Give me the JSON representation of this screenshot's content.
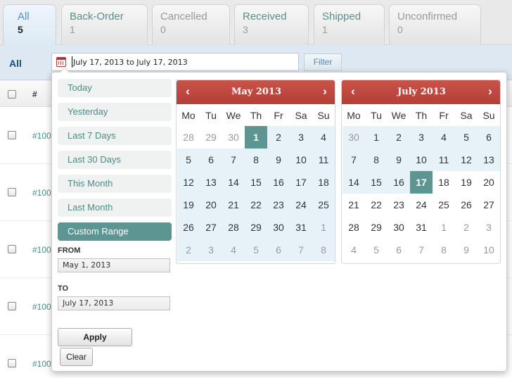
{
  "tabs": [
    {
      "label": "All",
      "count": "5"
    },
    {
      "label": "Back-Order",
      "count": "1"
    },
    {
      "label": "Cancelled",
      "count": "0"
    },
    {
      "label": "Received",
      "count": "3"
    },
    {
      "label": "Shipped",
      "count": "1"
    },
    {
      "label": "Unconfirmed",
      "count": "0"
    }
  ],
  "filter_bar": {
    "all_label": "All",
    "date_range": "July 17, 2013 to July 17, 2013",
    "filter_button": "Filter"
  },
  "table": {
    "hash_header": "#",
    "order_prefix": [
      "#100",
      "#100",
      "#100",
      "#100",
      "#100"
    ]
  },
  "picker": {
    "ranges": [
      "Today",
      "Yesterday",
      "Last 7 Days",
      "Last 30 Days",
      "This Month",
      "Last Month",
      "Custom Range"
    ],
    "active_range": "Custom Range",
    "from_label": "FROM",
    "from_value": "May 1, 2013",
    "to_label": "TO",
    "to_value": "July 17, 2013",
    "apply_button": "Apply",
    "clear_button": "Clear",
    "prev_icon": "‹",
    "next_icon": "›",
    "weekdays": [
      "Mo",
      "Tu",
      "We",
      "Th",
      "Fr",
      "Sa",
      "Su"
    ],
    "calendars": [
      {
        "title": "May 2013",
        "days": [
          {
            "d": "28",
            "m": true,
            "r": false,
            "s": false
          },
          {
            "d": "29",
            "m": true,
            "r": false,
            "s": false
          },
          {
            "d": "30",
            "m": true,
            "r": false,
            "s": false
          },
          {
            "d": "1",
            "m": false,
            "r": true,
            "s": true
          },
          {
            "d": "2",
            "m": false,
            "r": true,
            "s": false
          },
          {
            "d": "3",
            "m": false,
            "r": true,
            "s": false
          },
          {
            "d": "4",
            "m": false,
            "r": true,
            "s": false
          },
          {
            "d": "5",
            "m": false,
            "r": true,
            "s": false
          },
          {
            "d": "6",
            "m": false,
            "r": true,
            "s": false
          },
          {
            "d": "7",
            "m": false,
            "r": true,
            "s": false
          },
          {
            "d": "8",
            "m": false,
            "r": true,
            "s": false
          },
          {
            "d": "9",
            "m": false,
            "r": true,
            "s": false
          },
          {
            "d": "10",
            "m": false,
            "r": true,
            "s": false
          },
          {
            "d": "11",
            "m": false,
            "r": true,
            "s": false
          },
          {
            "d": "12",
            "m": false,
            "r": true,
            "s": false
          },
          {
            "d": "13",
            "m": false,
            "r": true,
            "s": false
          },
          {
            "d": "14",
            "m": false,
            "r": true,
            "s": false
          },
          {
            "d": "15",
            "m": false,
            "r": true,
            "s": false
          },
          {
            "d": "16",
            "m": false,
            "r": true,
            "s": false
          },
          {
            "d": "17",
            "m": false,
            "r": true,
            "s": false
          },
          {
            "d": "18",
            "m": false,
            "r": true,
            "s": false
          },
          {
            "d": "19",
            "m": false,
            "r": true,
            "s": false
          },
          {
            "d": "20",
            "m": false,
            "r": true,
            "s": false
          },
          {
            "d": "21",
            "m": false,
            "r": true,
            "s": false
          },
          {
            "d": "22",
            "m": false,
            "r": true,
            "s": false
          },
          {
            "d": "23",
            "m": false,
            "r": true,
            "s": false
          },
          {
            "d": "24",
            "m": false,
            "r": true,
            "s": false
          },
          {
            "d": "25",
            "m": false,
            "r": true,
            "s": false
          },
          {
            "d": "26",
            "m": false,
            "r": true,
            "s": false
          },
          {
            "d": "27",
            "m": false,
            "r": true,
            "s": false
          },
          {
            "d": "28",
            "m": false,
            "r": true,
            "s": false
          },
          {
            "d": "29",
            "m": false,
            "r": true,
            "s": false
          },
          {
            "d": "30",
            "m": false,
            "r": true,
            "s": false
          },
          {
            "d": "31",
            "m": false,
            "r": true,
            "s": false
          },
          {
            "d": "1",
            "m": true,
            "r": true,
            "s": false
          },
          {
            "d": "2",
            "m": true,
            "r": true,
            "s": false
          },
          {
            "d": "3",
            "m": true,
            "r": true,
            "s": false
          },
          {
            "d": "4",
            "m": true,
            "r": true,
            "s": false
          },
          {
            "d": "5",
            "m": true,
            "r": true,
            "s": false
          },
          {
            "d": "6",
            "m": true,
            "r": true,
            "s": false
          },
          {
            "d": "7",
            "m": true,
            "r": true,
            "s": false
          },
          {
            "d": "8",
            "m": true,
            "r": true,
            "s": false
          }
        ]
      },
      {
        "title": "July 2013",
        "days": [
          {
            "d": "30",
            "m": true,
            "r": true,
            "s": false
          },
          {
            "d": "1",
            "m": false,
            "r": true,
            "s": false
          },
          {
            "d": "2",
            "m": false,
            "r": true,
            "s": false
          },
          {
            "d": "3",
            "m": false,
            "r": true,
            "s": false
          },
          {
            "d": "4",
            "m": false,
            "r": true,
            "s": false
          },
          {
            "d": "5",
            "m": false,
            "r": true,
            "s": false
          },
          {
            "d": "6",
            "m": false,
            "r": true,
            "s": false
          },
          {
            "d": "7",
            "m": false,
            "r": true,
            "s": false
          },
          {
            "d": "8",
            "m": false,
            "r": true,
            "s": false
          },
          {
            "d": "9",
            "m": false,
            "r": true,
            "s": false
          },
          {
            "d": "10",
            "m": false,
            "r": true,
            "s": false
          },
          {
            "d": "11",
            "m": false,
            "r": true,
            "s": false
          },
          {
            "d": "12",
            "m": false,
            "r": true,
            "s": false
          },
          {
            "d": "13",
            "m": false,
            "r": true,
            "s": false
          },
          {
            "d": "14",
            "m": false,
            "r": true,
            "s": false
          },
          {
            "d": "15",
            "m": false,
            "r": true,
            "s": false
          },
          {
            "d": "16",
            "m": false,
            "r": true,
            "s": false
          },
          {
            "d": "17",
            "m": false,
            "r": false,
            "s": true
          },
          {
            "d": "18",
            "m": false,
            "r": false,
            "s": false
          },
          {
            "d": "19",
            "m": false,
            "r": false,
            "s": false
          },
          {
            "d": "20",
            "m": false,
            "r": false,
            "s": false
          },
          {
            "d": "21",
            "m": false,
            "r": false,
            "s": false
          },
          {
            "d": "22",
            "m": false,
            "r": false,
            "s": false
          },
          {
            "d": "23",
            "m": false,
            "r": false,
            "s": false
          },
          {
            "d": "24",
            "m": false,
            "r": false,
            "s": false
          },
          {
            "d": "25",
            "m": false,
            "r": false,
            "s": false
          },
          {
            "d": "26",
            "m": false,
            "r": false,
            "s": false
          },
          {
            "d": "27",
            "m": false,
            "r": false,
            "s": false
          },
          {
            "d": "28",
            "m": false,
            "r": false,
            "s": false
          },
          {
            "d": "29",
            "m": false,
            "r": false,
            "s": false
          },
          {
            "d": "30",
            "m": false,
            "r": false,
            "s": false
          },
          {
            "d": "31",
            "m": false,
            "r": false,
            "s": false
          },
          {
            "d": "1",
            "m": true,
            "r": false,
            "s": false
          },
          {
            "d": "2",
            "m": true,
            "r": false,
            "s": false
          },
          {
            "d": "3",
            "m": true,
            "r": false,
            "s": false
          },
          {
            "d": "4",
            "m": true,
            "r": false,
            "s": false
          },
          {
            "d": "5",
            "m": true,
            "r": false,
            "s": false
          },
          {
            "d": "6",
            "m": true,
            "r": false,
            "s": false
          },
          {
            "d": "7",
            "m": true,
            "r": false,
            "s": false
          },
          {
            "d": "8",
            "m": true,
            "r": false,
            "s": false
          },
          {
            "d": "9",
            "m": true,
            "r": false,
            "s": false
          },
          {
            "d": "10",
            "m": true,
            "r": false,
            "s": false
          }
        ]
      }
    ]
  },
  "colors": {
    "accent_teal": "#5d9593",
    "header_red": "#c9534a",
    "range_blue": "#e7f2f8",
    "link_teal": "#4c8a89"
  }
}
